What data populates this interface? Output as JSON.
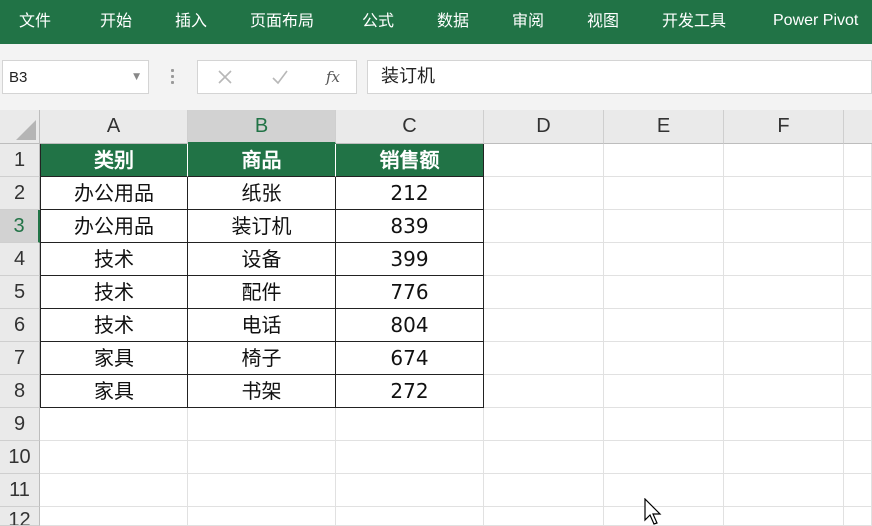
{
  "ribbon": {
    "tabs": [
      "文件",
      "开始",
      "插入",
      "页面布局",
      "公式",
      "数据",
      "审阅",
      "视图",
      "开发工具",
      "Power Pivot"
    ]
  },
  "formula_bar": {
    "name_box": "B3",
    "fx_label": "fx",
    "content": "装订机"
  },
  "sheet": {
    "columns": [
      "A",
      "B",
      "C",
      "D",
      "E",
      "F"
    ],
    "rows": [
      "1",
      "2",
      "3",
      "4",
      "5",
      "6",
      "7",
      "8",
      "9",
      "10",
      "11",
      "12"
    ],
    "headers": [
      "类别",
      "商品",
      "销售额"
    ],
    "data": [
      [
        "办公用品",
        "纸张",
        "212"
      ],
      [
        "办公用品",
        "装订机",
        "839"
      ],
      [
        "技术",
        "设备",
        "399"
      ],
      [
        "技术",
        "配件",
        "776"
      ],
      [
        "技术",
        "电话",
        "804"
      ],
      [
        "家具",
        "椅子",
        "674"
      ],
      [
        "家具",
        "书架",
        "272"
      ]
    ]
  },
  "colors": {
    "accent": "#217346",
    "header_text": "#ffffff"
  },
  "icons": {
    "cancel": "close-icon",
    "enter": "check-icon",
    "function": "function-icon",
    "cursor": "mouse-pointer-icon"
  }
}
